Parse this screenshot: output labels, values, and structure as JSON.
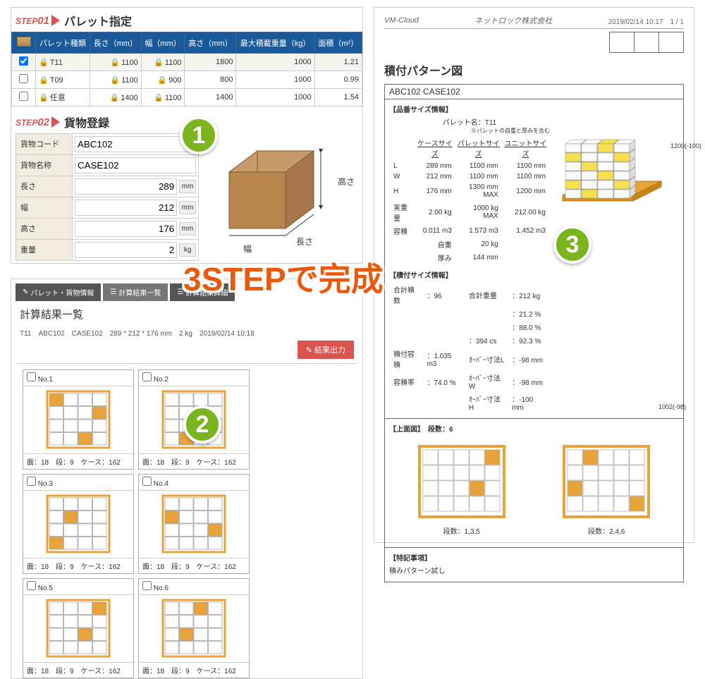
{
  "step1": {
    "badge": "STEP",
    "num": "01",
    "title": "パレット指定"
  },
  "step2": {
    "badge": "STEP",
    "num": "02",
    "title": "貨物登録"
  },
  "pallet_headers": [
    "パレット種類",
    "長さ（mm）",
    "幅（mm）",
    "高さ（mm）",
    "最大積載重量（kg）",
    "面積（m²）"
  ],
  "pallets": [
    {
      "checked": true,
      "name": "T11",
      "l": "1100",
      "w": "1100",
      "h": "1800",
      "wt": "1000",
      "area": "1.21"
    },
    {
      "name": "T09",
      "l": "1100",
      "w": "900",
      "h": "800",
      "wt": "1000",
      "area": "0.99"
    },
    {
      "name": "任意",
      "l": "1400",
      "w": "1100",
      "h": "1400",
      "wt": "1000",
      "area": "1.54"
    }
  ],
  "cargo": {
    "code_lbl": "貨物コード",
    "code": "ABC102",
    "name_lbl": "貨物名称",
    "name": "CASE102",
    "len_lbl": "長さ",
    "len": "289",
    "wid_lbl": "幅",
    "wid": "212",
    "hei_lbl": "高さ",
    "hei": "176",
    "wt_lbl": "重量",
    "wt": "2",
    "mm": "mm",
    "kg": "kg"
  },
  "dims": {
    "h": "高さ",
    "l": "長さ",
    "w": "幅"
  },
  "tabs": [
    "パレット・貨物情報",
    "計算結果一覧",
    "計算結果詳細"
  ],
  "calc": {
    "title": "計算結果一覧",
    "sub": "T11　ABC102　CASE102　289 * 212 * 176 mm　2 kg　2019/02/14 10:18",
    "btn": "結果出力",
    "btn_icon": "✎"
  },
  "results": [
    {
      "no": "No.1",
      "info": "面：18　段：9　ケース：162"
    },
    {
      "no": "No.2",
      "info": "面：18　段：9　ケース：162"
    },
    {
      "no": "No.3",
      "info": "面：18　段：9　ケース：162"
    },
    {
      "no": "No.4",
      "info": "面：18　段：9　ケース：162"
    },
    {
      "no": "No.5",
      "info": "面：18　段：9　ケース：162"
    },
    {
      "no": "No.6",
      "info": "面：18　段：9　ケース：162"
    }
  ],
  "doc": {
    "app": "VM-Cloud",
    "company": "ネットロック株式会社",
    "ts": "2019/02/14 10:17",
    "page": "1 / 1",
    "title": "積付パターン図",
    "case": "ABC102 CASE102",
    "sect1": "【品番サイズ情報】",
    "palname_lbl": "パレット名：",
    "palname": "T11",
    "note": "※パレットの自重と厚みを含む",
    "cols": [
      "ケースサイズ",
      "パレットサイズ",
      "ユニットサイズ"
    ],
    "rows": [
      [
        "L",
        "289 mm",
        "1100 mm",
        "1100 mm"
      ],
      [
        "W",
        "212 mm",
        "1100 mm",
        "1100 mm"
      ],
      [
        "H",
        "176 mm",
        "1300 mm MAX",
        "1200 mm"
      ],
      [
        "実重量",
        "2.00 kg",
        "1000 kg MAX",
        "212.00 kg"
      ],
      [
        "容積",
        "0.011 m3",
        "1.573 m3",
        "1.452 m3"
      ],
      [
        "",
        "自重",
        "20 kg",
        ""
      ],
      [
        "",
        "厚み",
        "144 mm",
        ""
      ]
    ],
    "sect2": "【積付サイズ情報】",
    "rows2": [
      [
        "合計積数",
        "：96",
        "合計重量",
        "：212 kg"
      ],
      [
        "",
        "",
        "",
        "：21.2 %"
      ],
      [
        "",
        "",
        "",
        "：88.0 %"
      ],
      [
        "",
        "",
        "：394 cs",
        "：92.3 %"
      ],
      [
        "積付容積",
        "：1.035 m3",
        "ｵｰﾊﾞｰ寸法L",
        "：-98 mm"
      ],
      [
        "容積率",
        "：74.0 %",
        "ｵｰﾊﾞｰ寸法W",
        "：-98 mm"
      ],
      [
        "",
        "",
        "ｵｰﾊﾞｰ寸法H",
        "：-100 mm"
      ]
    ],
    "dim1": "1200(-100)",
    "dim2": "1002(-98)",
    "sect3": "【上面図】　段数：6",
    "tv1": "段数：1,3,5",
    "tv2": "段数：2,4,6",
    "sect4": "【特記事項】",
    "memo": "積みパターン試し"
  },
  "badges": {
    "b1": "1",
    "b2": "2",
    "b3": "3"
  },
  "slogan": "3STEPで完成"
}
